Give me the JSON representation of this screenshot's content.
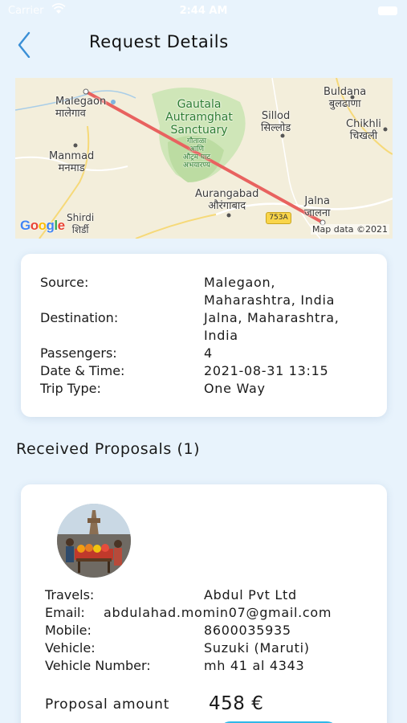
{
  "status_bar": {
    "carrier": "Carrier",
    "time": "2:44 AM"
  },
  "header": {
    "title": "Request Details"
  },
  "map": {
    "labels": {
      "malegaon": "Malegaon",
      "malegaon_local": "मालेगाव",
      "gautala": "Gautala\nAutramghat\nSanctuary",
      "gautala_local": "गौताळा\nआणि\nऔट्रम घाट\nअभयारण्य",
      "sillod": "Sillod",
      "sillod_local": "सिल्लोड",
      "buldana": "Buldana",
      "buldana_local": "बुलढाणा",
      "chikhli": "Chikhli",
      "chikhli_local": "चिखली",
      "manmad": "Manmad",
      "manmad_local": "मनमाड",
      "aurangabad": "Aurangabad",
      "aurangabad_local": "औरंगाबाद",
      "jalna": "Jalna",
      "jalna_local": "जालना",
      "shirdi": "Shirdi",
      "shirdi_local": "शिर्डी",
      "road": "753A"
    },
    "logo": "Google",
    "attribution": "Map data ©2021",
    "route_color": "#e8625f"
  },
  "request": {
    "source_label": "Source:",
    "source_line1": "Malegaon,",
    "source_line2": "Maharashtra, India",
    "destination_label": "Destination:",
    "destination_line1": "Jalna, Maharashtra,",
    "destination_line2": "India",
    "passengers_label": "Passengers:",
    "passengers_value": "4",
    "datetime_label": "Date & Time:",
    "datetime_value": "2021-08-31 13:15",
    "trip_type_label": "Trip Type:",
    "trip_type_value": "One Way"
  },
  "proposals": {
    "title": "Received Proposals (1)",
    "items": [
      {
        "travels_label": "Travels:",
        "travels_value": "Abdul Pvt Ltd",
        "email_label": "Email:",
        "email_value": "abdulahad.momin07@gmail.com",
        "mobile_label": "Mobile:",
        "mobile_value": "8600035935",
        "vehicle_label": "Vehicle:",
        "vehicle_value": "Suzuki (Maruti)",
        "vehicle_number_label": "Vehicle Number:",
        "vehicle_number_value": "mh 41 al 4343",
        "amount_label": "Proposal amount",
        "amount_value": "458 €"
      }
    ]
  },
  "colors": {
    "background": "#e8f3fc",
    "accent": "#2fb8e8",
    "back_arrow": "#3a8fd6"
  }
}
